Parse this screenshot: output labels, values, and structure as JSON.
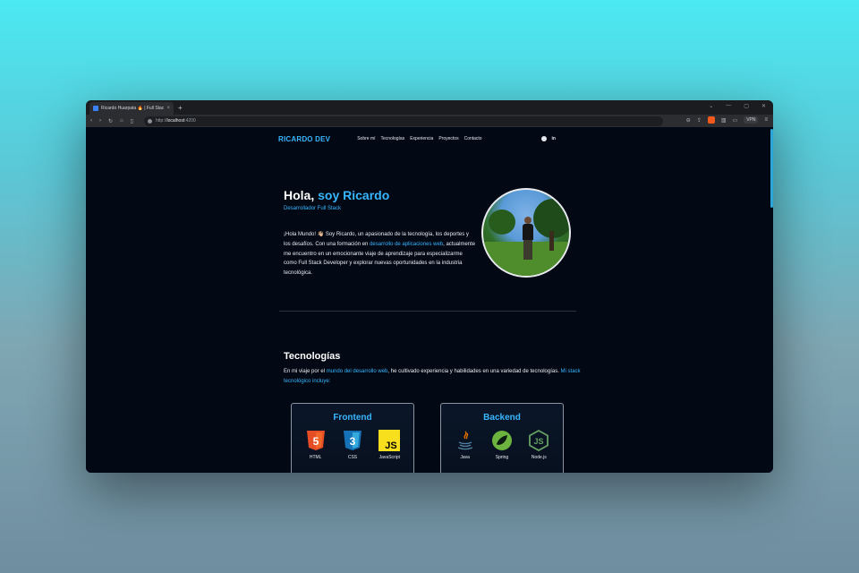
{
  "browser": {
    "tab_title": "Ricardo Huarpata 🔥 | Full Stack",
    "tab_close": "×",
    "new_tab": "+",
    "url_prefix": "http://",
    "url_host": "localhost",
    "url_rest": ":4200",
    "vpn_label": "VPN",
    "window_controls": [
      "⌄",
      "—",
      "▢",
      "✕"
    ]
  },
  "nav": {
    "logo": "RICARDO DEV",
    "links": [
      "Sobre mí",
      "Tecnologías",
      "Experiencia",
      "Proyectos",
      "Contacto"
    ],
    "linkedin": "in"
  },
  "hero": {
    "greeting": "Hola,",
    "name": "soy Ricardo",
    "subtitle": "Desarrollador Full Stack",
    "p1": "¡Hola Mundo! 👋🏼 Soy Ricardo, un apasionado de la tecnología, los deportes y los desafíos. Con una formación en ",
    "p_highlight": "desarrollo de aplicaciones web",
    "p2": ", actualmente me encuentro en un emocionante viaje de aprendizaje para especializarme como Full Stack Developer y explorar nuevas oportunidades en la industria tecnológica."
  },
  "tech": {
    "title": "Tecnologías",
    "t1": "En mi viaje por el ",
    "t_hl1": "mundo del desarrollo web",
    "t2": ", he cultivado experiencia y habilidades en una variedad de tecnologías. ",
    "t_hl2": "Mi stack tecnológico incluye:",
    "cards": [
      {
        "title": "Frontend",
        "items": [
          {
            "label": "HTML",
            "icon": "html5-icon"
          },
          {
            "label": "CSS",
            "icon": "css3-icon"
          },
          {
            "label": "JavaScript",
            "icon": "javascript-icon"
          }
        ]
      },
      {
        "title": "Backend",
        "items": [
          {
            "label": "Java",
            "icon": "java-icon"
          },
          {
            "label": "Spring",
            "icon": "spring-icon"
          },
          {
            "label": "Node.js",
            "icon": "nodejs-icon"
          }
        ]
      }
    ]
  },
  "colors": {
    "accent": "#38b6ff",
    "background": "#020814"
  }
}
